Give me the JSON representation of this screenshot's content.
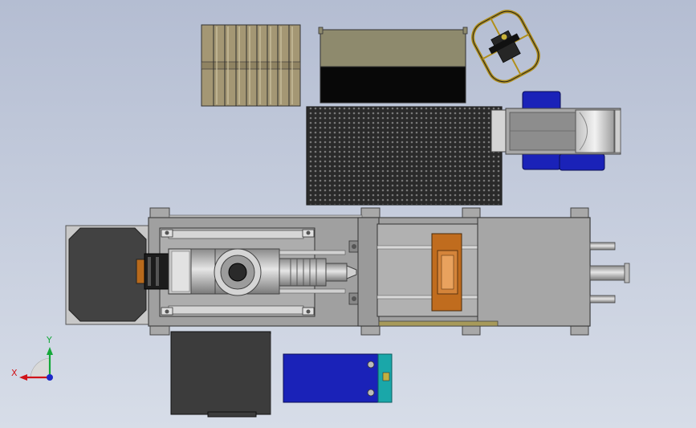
{
  "triad": {
    "x_label": "X",
    "y_label": "Y",
    "x_color": "#d0141a",
    "y_color": "#15a83a",
    "z_color": "#1c28c8"
  },
  "palette": {
    "bg_top": "#b6bfd4",
    "bg_bottom": "#d6dde9",
    "steel": "#a3a3a3",
    "steel_light": "#cfcfcf",
    "steel_dark": "#6a6a6a",
    "dark_grey": "#3d3d3d",
    "near_black": "#151515",
    "olive": "#8b8566",
    "wood": "#a79a76",
    "blue": "#1a22b8",
    "cyan": "#1aa7a9",
    "orange": "#c06c1e"
  }
}
